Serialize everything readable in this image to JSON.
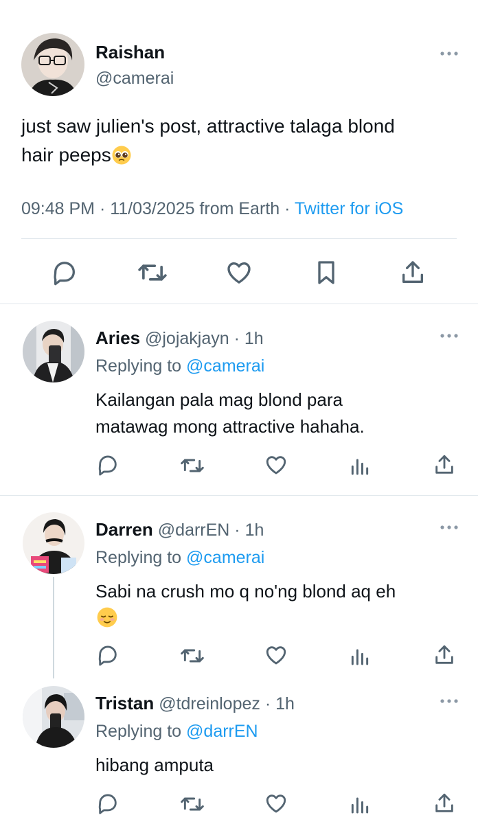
{
  "main_tweet": {
    "name": "Raishan",
    "handle": "@camerai",
    "text_line1": "just saw julien's post, attractive talaga blond",
    "text_line2": "hair peeps",
    "emoji": "pleading-face",
    "meta_time_date": "09:48 PM · 11/03/2025 from Earth · ",
    "meta_source": "Twitter for iOS",
    "actions": [
      "reply-icon",
      "retweet-icon",
      "like-icon",
      "bookmark-icon",
      "share-icon"
    ]
  },
  "replies": [
    {
      "name": "Aries",
      "handle": "@jojakjayn",
      "time": " · 1h",
      "replying_prefix": "Replying to ",
      "replying_to": "@camerai",
      "line1": "Kailangan pala mag blond para",
      "line2": "matawag mong attractive hahaha."
    },
    {
      "name": "Darren",
      "handle": "@darrEN",
      "time": " · 1h",
      "replying_prefix": "Replying to ",
      "replying_to": "@camerai",
      "line1": "Sabi na crush mo q no'ng blond aq eh",
      "emoji": "relieved-face"
    },
    {
      "name": "Tristan",
      "handle": "@tdreinlopez",
      "time": " · 1h",
      "replying_prefix": "Replying to ",
      "replying_to": "@darrEN",
      "line1": "hibang amputa"
    }
  ],
  "colors": {
    "link": "#1d9bf0",
    "muted": "#536471",
    "text": "#0f1419",
    "divider": "#e1e8ed"
  }
}
